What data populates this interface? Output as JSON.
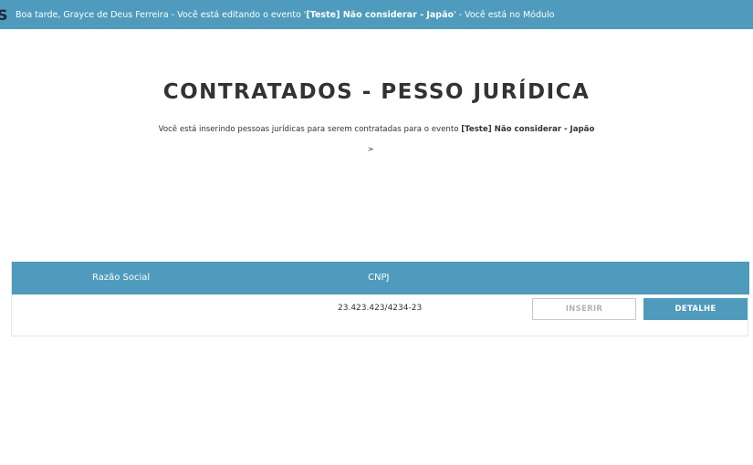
{
  "topbar": {
    "logo_letter": "S",
    "greeting": "Boa tarde, Grayce de Deus Ferreira - Você está editando o evento '",
    "event_name": "[Teste] Não considerar - Japão",
    "module_text": "' - Você está no Módulo"
  },
  "header": {
    "title": "CONTRATADOS - PESSO JURÍDICA",
    "subtitle_prefix": "Você está inserindo pessoas jurídicas para serem contratadas para o evento ",
    "subtitle_event": "[Teste] Não considerar - Japão",
    "separator": ">"
  },
  "table": {
    "columns": {
      "razao_social": "Razão Social",
      "cnpj": "CNPJ"
    },
    "rows": [
      {
        "razao_social": "",
        "cnpj": "23.423.423/4234-23",
        "insert_label": "INSERIR",
        "detail_label": "DETALHE"
      }
    ]
  },
  "colors": {
    "accent": "#4f9bbd",
    "text": "#333333"
  }
}
